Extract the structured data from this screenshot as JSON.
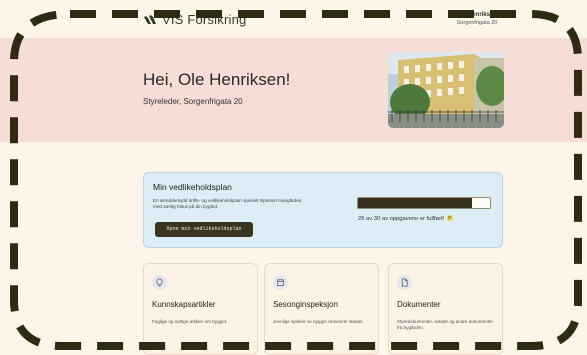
{
  "header": {
    "logo_text": "VIS Forsikring",
    "user_name": "Ole Henriksen",
    "user_address": "Sorgenfrigata 20"
  },
  "hero": {
    "greeting": "Hei, Ole Henriksen!",
    "subtitle": "Styreleder, Sorgenfrigata 20"
  },
  "plan": {
    "title": "Min vedlikeholdsplan",
    "description": "En skreddersydd drifts- og vedlikeholdsplan spesielt tilpasset mangården, med særlig fokus på din bygård.",
    "button_label": "Åpne min vedlikeholdsplan",
    "progress_done": 26,
    "progress_total": 30,
    "progress_text": "26 av 30 av oppgavene er fullført!"
  },
  "cards": [
    {
      "icon": "lightbulb-icon",
      "title": "Kunnskapsartikler",
      "desc": "Faglige og nyttige artikler om bygget."
    },
    {
      "icon": "calendar-icon",
      "title": "Sesonginspeksjon",
      "desc": "Jevnlige sjekker av bygget reduserer skader."
    },
    {
      "icon": "document-icon",
      "title": "Dokumenter",
      "desc": "Styredokumenter, avtaler og andre dokumenter fra bygården."
    }
  ],
  "colors": {
    "hero_bg": "#f6ddd6",
    "plan_bg": "#dcedf6",
    "accent_dark": "#35311c",
    "page_bg": "#fdf4ea"
  }
}
